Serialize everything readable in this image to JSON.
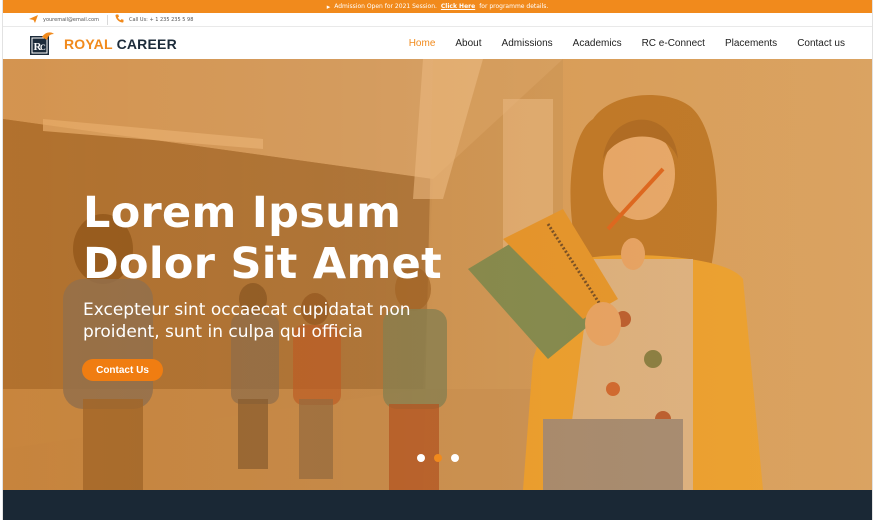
{
  "announcement": {
    "prefix": "Admission Open for  2021 Session.",
    "link": "Click Here",
    "suffix": "for programme details."
  },
  "contact": {
    "email": "youremail@email.com",
    "phone": "Call Us: + 1 235 235 5 98"
  },
  "brand": {
    "part1": "ROYAL",
    "part2": "CAREER"
  },
  "nav": [
    {
      "label": "Home",
      "active": true
    },
    {
      "label": "About"
    },
    {
      "label": "Admissions"
    },
    {
      "label": "Academics"
    },
    {
      "label": "RC e-Connect"
    },
    {
      "label": "Placements"
    },
    {
      "label": "Contact us"
    }
  ],
  "hero": {
    "title_line1": "Lorem Ipsum",
    "title_line2": "Dolor Sit Amet",
    "subtitle_line1": "Excepteur sint occaecat cupidatat non",
    "subtitle_line2": "proident, sunt in culpa qui officia",
    "cta": "Contact Us",
    "slides": 3,
    "active_slide": 2
  },
  "colors": {
    "accent": "#f18a1c",
    "dark": "#1a2835"
  }
}
